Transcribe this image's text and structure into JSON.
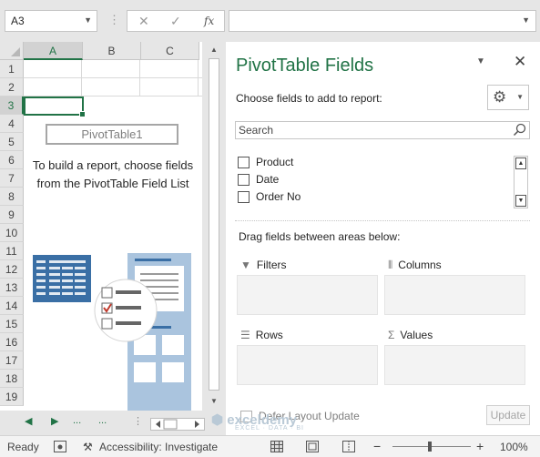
{
  "formula_bar": {
    "name_box": "A3",
    "fx_label": "fx",
    "cancel_glyph": "✕",
    "enter_glyph": "✓",
    "value": ""
  },
  "grid": {
    "columns": [
      "A",
      "B",
      "C"
    ],
    "selected_column": "A",
    "rows": [
      "1",
      "2",
      "3",
      "4",
      "5",
      "6",
      "7",
      "8",
      "9",
      "10",
      "11",
      "12",
      "13",
      "14",
      "15",
      "16",
      "17",
      "18",
      "19"
    ],
    "selected_row": "3"
  },
  "pivot_placeholder": {
    "name": "PivotTable1",
    "help_text": "To build a report, choose fields from the PivotTable Field List"
  },
  "sheet_nav": {
    "prev": "◀",
    "next": "▶",
    "more_left": "...",
    "more_right": "..."
  },
  "pane": {
    "title": "PivotTable Fields",
    "choose_label": "Choose fields to add to report:",
    "search_placeholder": "Search",
    "fields": [
      {
        "label": "Product",
        "checked": false
      },
      {
        "label": "Date",
        "checked": false
      },
      {
        "label": "Order No",
        "checked": false
      }
    ],
    "drag_label": "Drag fields between areas below:",
    "areas": {
      "filters": "Filters",
      "columns": "Columns",
      "rows": "Rows",
      "values": "Values"
    },
    "defer_label": "Defer Layout Update",
    "update_label": "Update"
  },
  "status_bar": {
    "ready": "Ready",
    "accessibility": "Accessibility: Investigate",
    "zoom_out": "−",
    "zoom_in": "+",
    "zoom": "100%"
  },
  "watermark": {
    "brand": "exceldemy",
    "tagline": "EXCEL · DATA · BI"
  },
  "colors": {
    "accent": "#217346",
    "chrome": "#e6e6e6",
    "illustration_blue": "#3a6fa5"
  }
}
